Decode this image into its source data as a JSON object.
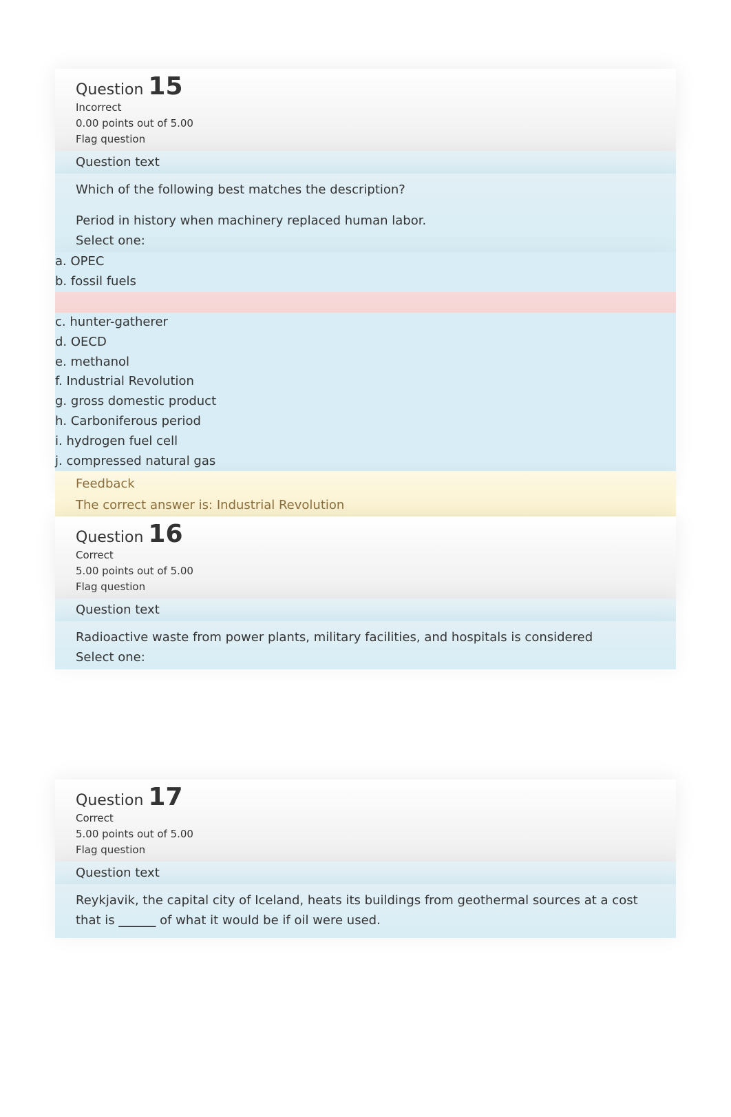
{
  "q15": {
    "label": "Question",
    "number": "15",
    "status": "Incorrect",
    "points": "0.00 points out of 5.00",
    "flag": "Flag question",
    "section_label": "Question text",
    "prompt1": "Which of the following best matches the description?",
    "prompt2": "Period in history when machinery replaced human labor.",
    "select_one": "Select one:",
    "options": {
      "a": "a. OPEC",
      "b": "b. fossil fuels",
      "c": "c. hunter-gatherer",
      "d": "d. OECD",
      "e": "e. methanol",
      "f": "f. Industrial Revolution",
      "g": "g. gross domestic product",
      "h": "h. Carboniferous period",
      "i": "i. hydrogen fuel cell",
      "j": "j. compressed natural gas"
    },
    "feedback_label": "Feedback",
    "feedback_text": "The correct answer is: Industrial Revolution"
  },
  "q16": {
    "label": "Question",
    "number": "16",
    "status": "Correct",
    "points": "5.00 points out of 5.00",
    "flag": "Flag question",
    "section_label": "Question text",
    "prompt1": "Radioactive waste from power plants, military facilities, and hospitals is considered",
    "select_one": "Select one:"
  },
  "q17": {
    "label": "Question",
    "number": "17",
    "status": "Correct",
    "points": "5.00 points out of 5.00",
    "flag": "Flag question",
    "section_label": "Question text",
    "prompt1": "Reykjavik, the capital city of Iceland, heats its buildings from geothermal sources at a cost that is ______ of what it would be if oil were used."
  }
}
